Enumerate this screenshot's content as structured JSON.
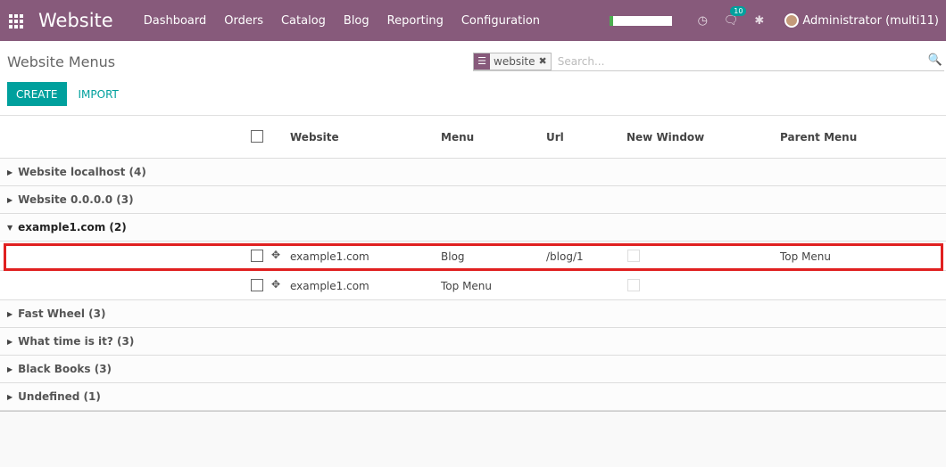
{
  "navbar": {
    "brand": "Website",
    "menu": [
      "Dashboard",
      "Orders",
      "Catalog",
      "Blog",
      "Reporting",
      "Configuration"
    ],
    "chat_badge": "10",
    "user": "Administrator (multi11)",
    "bg_color": "#875a7b"
  },
  "control_panel": {
    "title": "Website Menus",
    "search": {
      "facet_value": "website",
      "placeholder": "Search..."
    },
    "buttons": {
      "create": "CREATE",
      "import": "IMPORT"
    }
  },
  "table": {
    "columns": [
      "Website",
      "Menu",
      "Url",
      "New Window",
      "Parent Menu"
    ],
    "groups": [
      {
        "label": "Website localhost (4)",
        "open": false
      },
      {
        "label": "Website 0.0.0.0 (3)",
        "open": false
      },
      {
        "label": "example1.com (2)",
        "open": true,
        "rows": [
          {
            "website": "example1.com",
            "menu": "Blog",
            "url": "/blog/1",
            "parent": "Top Menu",
            "highlighted": true
          },
          {
            "website": "example1.com",
            "menu": "Top Menu",
            "url": "",
            "parent": "",
            "highlighted": false
          }
        ]
      },
      {
        "label": "Fast Wheel (3)",
        "open": false
      },
      {
        "label": "What time is it? (3)",
        "open": false
      },
      {
        "label": "Black Books (3)",
        "open": false
      },
      {
        "label": "Undefined (1)",
        "open": false
      }
    ]
  },
  "colors": {
    "accent": "#00a09d",
    "highlight_border": "#e02020"
  }
}
